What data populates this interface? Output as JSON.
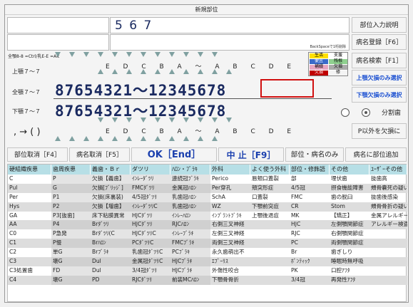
{
  "title": "新規部位",
  "input_value": "5 6 7",
  "small_note": "BackSpaceで1桁削除",
  "shortcut_hint": "全顎8-8 =Ctrl/乳E-E =Alt",
  "right_buttons": {
    "b1": "部位入力説明",
    "b2": "病名登録［F6］",
    "b3": "病名検索［F1］",
    "b4": "上顎欠損のみ選択",
    "b5": "下顎欠損のみ選択",
    "b6": "分割歯",
    "b7": "P以外を欠損に"
  },
  "left_labels": {
    "upper": "上顎７～７",
    "all": "全顎７～７",
    "lower": "下顎７～７"
  },
  "upper_letters": "E D C B A ～ A B C D E",
  "upper_digits": "87654321～12345678",
  "lower_digits": "87654321～12345678",
  "lower_letters": "E D C B A ～ A B C D E",
  "symbols": ", →  ( )",
  "legend": {
    "r1a": "生活",
    "r1b": "支援",
    "r2a": "便宜",
    "r2b": "残根",
    "r3a": "補綴",
    "r3b": "欠損",
    "r4a": "欠損",
    "r4b": "修"
  },
  "toolbar": {
    "cancel_site": "部位取消［F4］",
    "cancel_disease": "病名取消［F5］",
    "ok": "OK［End］",
    "stop": "中 止［F9］",
    "site_disease": "部位・病名のみ",
    "add_site": "病名に部位追加"
  },
  "columns": [
    {
      "header": "硬組織疾患",
      "items": [
        "C",
        "Pul",
        "Per",
        "Hys",
        "GA",
        "AA",
        "C0",
        "C1",
        "C2",
        "C3",
        "C3処置歯",
        "C4"
      ]
    },
    {
      "header": "歯周疾患",
      "items": [
        "P",
        "G",
        "P1",
        "P2",
        "P3[抜歯]",
        "P4",
        "P急発",
        "P慢",
        "単G",
        "壊G",
        "FD",
        "壊G"
      ]
    },
    {
      "header": "義歯・Ｂｒ",
      "items": [
        "欠損【義歯】",
        "欠損[ﾌﾞﾘｯｼﾞ]",
        "欠損(床裏装)",
        "欠損【増歯】",
        "床下粘膜異常",
        "Brﾀﾞﾂﾘ",
        "Brﾀﾞﾂﾘ(C",
        "Brﾊﾛﾝ",
        "Brﾌﾞﾗｷ",
        "Dul",
        "Dul",
        "PD"
      ]
    },
    {
      "header": "ダツリ",
      "items": [
        "ｲﾝﾚｰﾀﾞﾂﾘ",
        "FMCﾀﾞﾂﾘ",
        "4/5冠ﾀﾞﾂﾘ",
        "ｲﾝﾚｰﾀﾞﾂﾘC",
        "HJCﾀﾞﾂﾘ",
        "HJCﾀﾞﾂﾘ",
        "HJCﾀﾞﾂﾘC",
        "PCﾀﾞﾂﾘC",
        "乳歯冠ﾀﾞﾂﾘC",
        "金属冠ﾀﾞﾂﾘC",
        "3/4冠ﾀﾞﾂﾘ",
        "RJCﾀﾞﾂﾘ"
      ]
    },
    {
      "header": "ﾊﾛﾝ・ﾌﾞﾗｷ",
      "items": [
        "連続冠ﾌﾞﾗｷ",
        "金属冠ﾊﾛﾝ",
        "乳歯冠ﾊﾛﾝ",
        "乳歯冠ﾊﾛﾝ",
        "ｲﾝﾚｰﾊﾛﾝ",
        "RJCﾊﾛﾝ",
        "ｲﾝﾚｰﾌﾞﾗｷ",
        "FMCﾌﾞﾗｷ",
        "PCﾌﾞﾗｷ",
        "HJCﾌﾞﾗｷ",
        "HJCﾌﾞﾗｷ",
        "前装MCﾊﾛﾝ"
      ]
    },
    {
      "header": "外科",
      "items": [
        "Perico",
        "Per穿孔",
        "SchA",
        "WZ",
        "ｲﾝﾌﾟﾗﾝﾄﾌﾞﾗｷ",
        "右側三叉神経",
        "左側三叉神経",
        "両側三叉神経",
        "永久歯萌出不",
        "ｴﾌﾟｰﾘｽ",
        "外傷性咬合",
        "下顎骨骨折"
      ]
    },
    {
      "header": "よく使う外科",
      "items": [
        "唇頬口蓋裂",
        "頬突形症",
        "口蓋裂",
        "下顎前突症",
        "上顎後退症",
        "",
        "",
        "",
        "",
        "",
        "",
        ""
      ]
    },
    {
      "header": "部位・修飾語",
      "items": [
        "部",
        "4/5冠",
        "FMC",
        "CR",
        "MK",
        "HJC",
        "RJC",
        "PC",
        "Br",
        "ﾎﾟﾝﾃｨｯｸ",
        "PK",
        "3/4冠"
      ]
    },
    {
      "header": "その他",
      "items": [
        "埋伏歯",
        "摂食機能障害",
        "歯の脱臼",
        "Stom",
        "【矯正】",
        "左側顎関節症",
        "右側顎関節症",
        "両側顎関節症",
        "歯ぎしり",
        "睡眠時無呼吸",
        "口腔ｱﾌﾀ",
        "再発性ｱﾌﾀ"
      ]
    },
    {
      "header": "ﾕｰｻﾞｰその他",
      "items": [
        "抜歯高",
        "頰骨嚢死の疑い",
        "抜歯後感染",
        "頰骨骨折の疑い",
        "金属アレルギー",
        "アレルギー検査",
        "",
        "",
        "",
        "",
        "",
        ""
      ]
    }
  ]
}
